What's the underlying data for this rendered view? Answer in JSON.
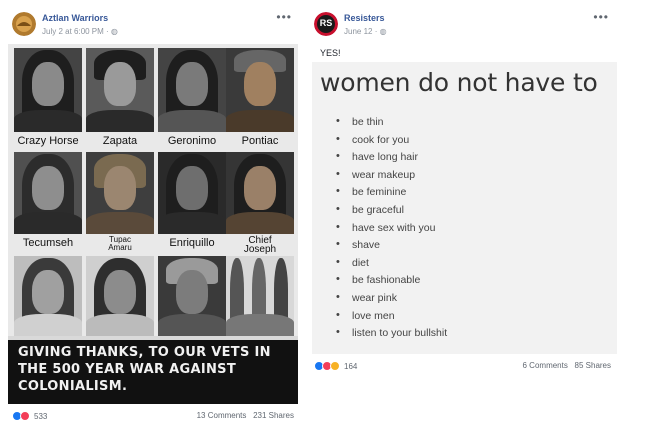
{
  "left_post": {
    "author": "Aztlan Warriors",
    "timestamp": "July 2 at 6:00 PM",
    "privacy_icon": "globe-icon",
    "more_label": "•••",
    "portraits": [
      {
        "label": "Crazy Horse"
      },
      {
        "label": "Zapata"
      },
      {
        "label": "Geronimo"
      },
      {
        "label": "Pontiac"
      },
      {
        "label": "Tecumseh"
      },
      {
        "label": "Tupac\nAmaru"
      },
      {
        "label": "Enriquillo"
      },
      {
        "label": "Chief\nJoseph"
      },
      {
        "label": ""
      },
      {
        "label": ""
      },
      {
        "label": ""
      },
      {
        "label": ""
      }
    ],
    "banner_line1": "GIVING THANKS, TO OUR VETS IN",
    "banner_line2": "THE 500 YEAR WAR AGAINST",
    "banner_line3": "COLONIALISM.",
    "reaction_count": "533",
    "comments": "13 Comments",
    "shares": "231 Shares"
  },
  "right_post": {
    "author": "Resisters",
    "avatar_text": "RS",
    "timestamp": "June 12",
    "privacy_icon": "globe-icon",
    "more_label": "•••",
    "post_text": "YES!",
    "headline": "women do not have to",
    "items": [
      "be thin",
      "cook for you",
      "have long hair",
      "wear makeup",
      "be feminine",
      "be graceful",
      "have sex with you",
      "shave",
      "diet",
      "be fashionable",
      "wear pink",
      "love men",
      "listen to your bullshit"
    ],
    "reaction_count": "164",
    "comments": "6 Comments",
    "shares": "85 Shares"
  },
  "colors": {
    "link_blue": "#385898",
    "like_blue": "#1877f2",
    "love_red": "#f33e58",
    "haha_yellow": "#f7b125",
    "banner_bg": "#111111"
  }
}
